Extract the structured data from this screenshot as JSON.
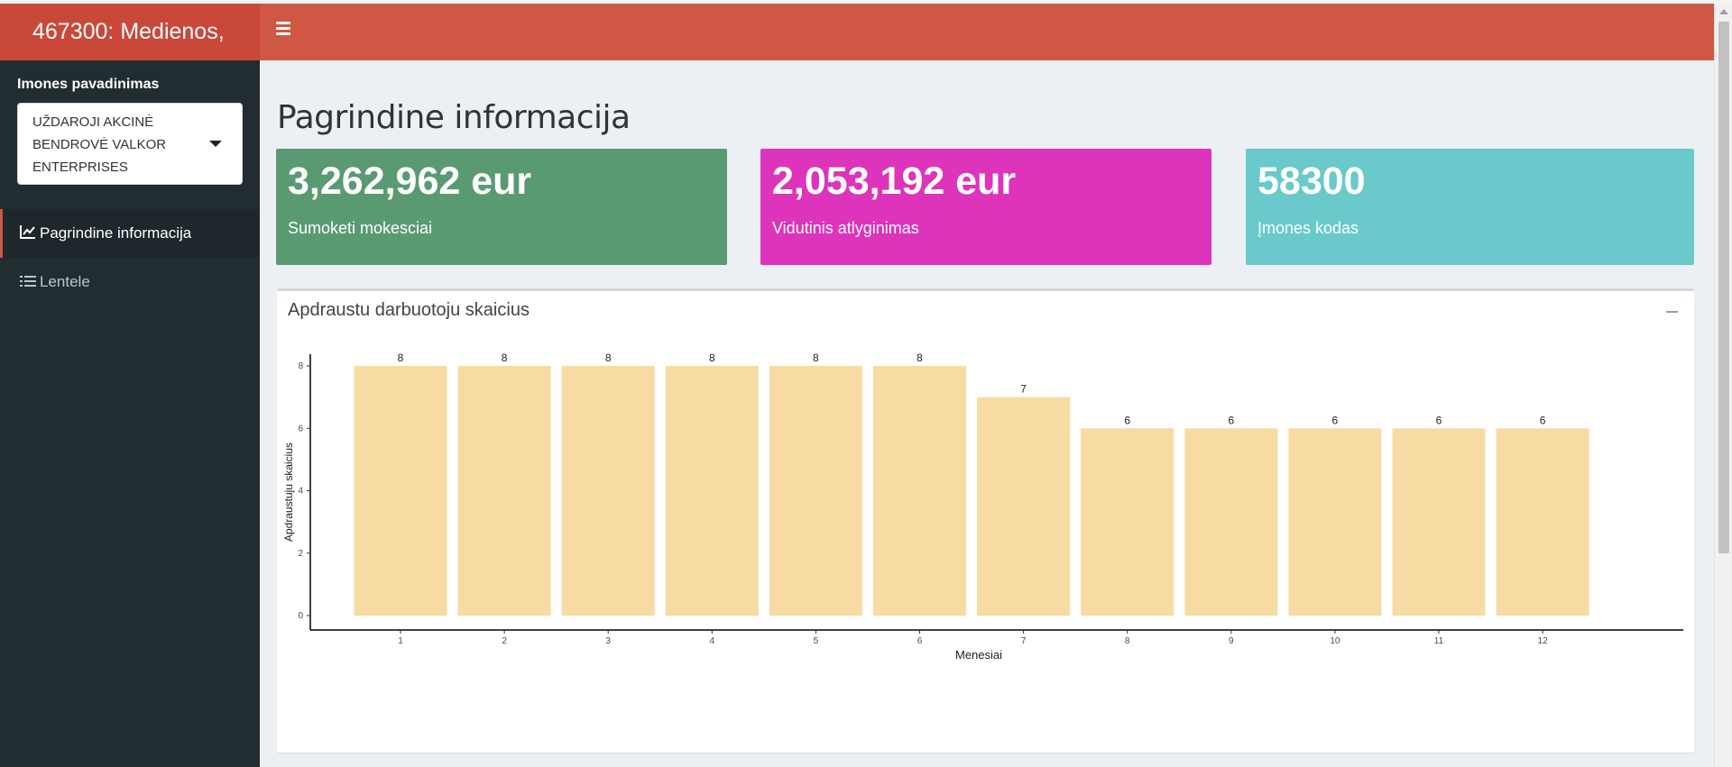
{
  "header": {
    "title": "467300: Medienos,"
  },
  "sidebar": {
    "company_label": "Imones pavadinimas",
    "company_select": {
      "lines": [
        "UŽDAROJI AKCINĖ",
        "BENDROVĖ VALKOR",
        "ENTERPRISES"
      ]
    },
    "items": [
      {
        "label": "Pagrindine informacija",
        "icon": "line-chart-icon",
        "active": true
      },
      {
        "label": "Lentele",
        "icon": "list-icon",
        "active": false
      }
    ]
  },
  "main": {
    "title": "Pagrindine informacija",
    "value_boxes": [
      {
        "value": "3,262,962 eur",
        "subtitle": "Sumoketi mokesciai",
        "color": "#5a9a73"
      },
      {
        "value": "2,053,192 eur",
        "subtitle": "Vidutinis atlyginimas",
        "color": "#dd34bb"
      },
      {
        "value": "58300",
        "subtitle": "Įmones kodas",
        "color": "#69c9cb"
      }
    ],
    "chart_box": {
      "title": "Apdraustu darbuotoju skaicius"
    }
  },
  "chart_data": {
    "type": "bar",
    "categories": [
      "1",
      "2",
      "3",
      "4",
      "5",
      "6",
      "7",
      "8",
      "9",
      "10",
      "11",
      "12"
    ],
    "values": [
      8,
      8,
      8,
      8,
      8,
      8,
      7,
      6,
      6,
      6,
      6,
      6
    ],
    "data_labels": [
      "8",
      "8",
      "8",
      "8",
      "8",
      "8",
      "7",
      "6",
      "6",
      "6",
      "6",
      "6"
    ],
    "xlabel": "Menesiai",
    "ylabel": "Apdraustuju skaicius",
    "ylim": [
      0,
      8
    ],
    "yticks": [
      "0",
      "2",
      "4",
      "6",
      "8"
    ],
    "bar_color": "#f7dba2",
    "grid": false
  }
}
